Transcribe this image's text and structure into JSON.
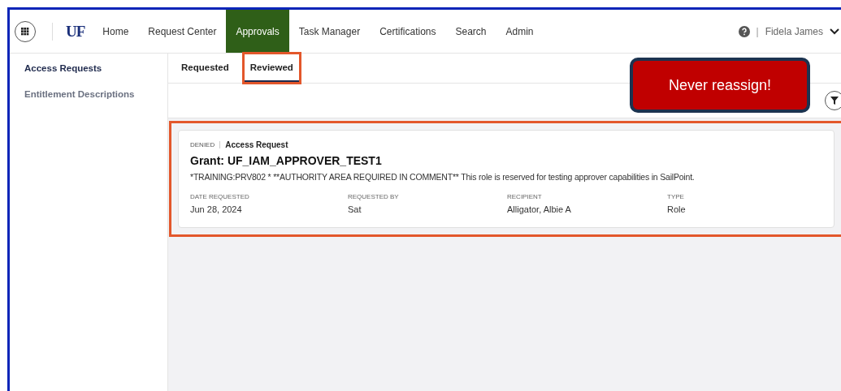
{
  "nav": {
    "logo": "UF",
    "items": [
      {
        "label": "Home",
        "selected": false
      },
      {
        "label": "Request Center",
        "selected": false
      },
      {
        "label": "Approvals",
        "selected": true
      },
      {
        "label": "Task Manager",
        "selected": false
      },
      {
        "label": "Certifications",
        "selected": false
      },
      {
        "label": "Search",
        "selected": false
      },
      {
        "label": "Admin",
        "selected": false
      }
    ],
    "separator": "|",
    "user": "Fidela James"
  },
  "sidebar": {
    "items": [
      {
        "label": "Access Requests",
        "selected": true
      },
      {
        "label": "Entitlement Descriptions",
        "selected": false
      }
    ]
  },
  "tabs": [
    {
      "label": "Requested",
      "selected": false,
      "highlighted": false
    },
    {
      "label": "Reviewed",
      "selected": true,
      "highlighted": true
    }
  ],
  "callout": "Never reassign!",
  "cards": [
    {
      "highlighted": true,
      "status": "DENIED",
      "kind": "Access Request",
      "title": "Grant: UF_IAM_APPROVER_TEST1",
      "description": "*TRAINING:PRV802 * **AUTHORITY AREA REQUIRED IN COMMENT** This role is reserved for testing approver capabilities in SailPoint.",
      "fields": [
        {
          "label": "DATE REQUESTED",
          "value": "Jun 28, 2024"
        },
        {
          "label": "REQUESTED BY",
          "value": "Sat"
        },
        {
          "label": "RECIPIENT",
          "value": "Alligator, Albie A"
        },
        {
          "label": "TYPE",
          "value": "Role"
        }
      ]
    }
  ]
}
